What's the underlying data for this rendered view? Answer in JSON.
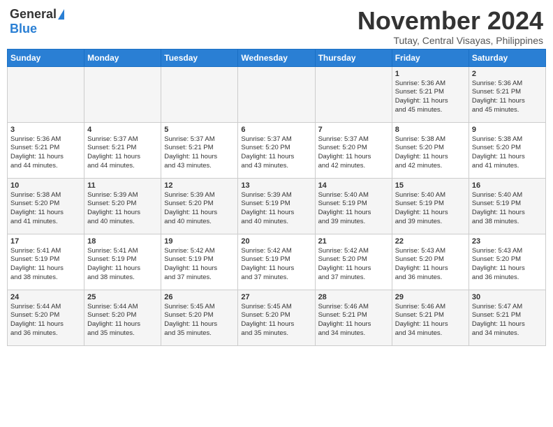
{
  "header": {
    "logo_general": "General",
    "logo_blue": "Blue",
    "month": "November 2024",
    "location": "Tutay, Central Visayas, Philippines"
  },
  "weekdays": [
    "Sunday",
    "Monday",
    "Tuesday",
    "Wednesday",
    "Thursday",
    "Friday",
    "Saturday"
  ],
  "weeks": [
    [
      {
        "day": "",
        "info": ""
      },
      {
        "day": "",
        "info": ""
      },
      {
        "day": "",
        "info": ""
      },
      {
        "day": "",
        "info": ""
      },
      {
        "day": "",
        "info": ""
      },
      {
        "day": "1",
        "info": "Sunrise: 5:36 AM\nSunset: 5:21 PM\nDaylight: 11 hours\nand 45 minutes."
      },
      {
        "day": "2",
        "info": "Sunrise: 5:36 AM\nSunset: 5:21 PM\nDaylight: 11 hours\nand 45 minutes."
      }
    ],
    [
      {
        "day": "3",
        "info": "Sunrise: 5:36 AM\nSunset: 5:21 PM\nDaylight: 11 hours\nand 44 minutes."
      },
      {
        "day": "4",
        "info": "Sunrise: 5:37 AM\nSunset: 5:21 PM\nDaylight: 11 hours\nand 44 minutes."
      },
      {
        "day": "5",
        "info": "Sunrise: 5:37 AM\nSunset: 5:21 PM\nDaylight: 11 hours\nand 43 minutes."
      },
      {
        "day": "6",
        "info": "Sunrise: 5:37 AM\nSunset: 5:20 PM\nDaylight: 11 hours\nand 43 minutes."
      },
      {
        "day": "7",
        "info": "Sunrise: 5:37 AM\nSunset: 5:20 PM\nDaylight: 11 hours\nand 42 minutes."
      },
      {
        "day": "8",
        "info": "Sunrise: 5:38 AM\nSunset: 5:20 PM\nDaylight: 11 hours\nand 42 minutes."
      },
      {
        "day": "9",
        "info": "Sunrise: 5:38 AM\nSunset: 5:20 PM\nDaylight: 11 hours\nand 41 minutes."
      }
    ],
    [
      {
        "day": "10",
        "info": "Sunrise: 5:38 AM\nSunset: 5:20 PM\nDaylight: 11 hours\nand 41 minutes."
      },
      {
        "day": "11",
        "info": "Sunrise: 5:39 AM\nSunset: 5:20 PM\nDaylight: 11 hours\nand 40 minutes."
      },
      {
        "day": "12",
        "info": "Sunrise: 5:39 AM\nSunset: 5:20 PM\nDaylight: 11 hours\nand 40 minutes."
      },
      {
        "day": "13",
        "info": "Sunrise: 5:39 AM\nSunset: 5:19 PM\nDaylight: 11 hours\nand 40 minutes."
      },
      {
        "day": "14",
        "info": "Sunrise: 5:40 AM\nSunset: 5:19 PM\nDaylight: 11 hours\nand 39 minutes."
      },
      {
        "day": "15",
        "info": "Sunrise: 5:40 AM\nSunset: 5:19 PM\nDaylight: 11 hours\nand 39 minutes."
      },
      {
        "day": "16",
        "info": "Sunrise: 5:40 AM\nSunset: 5:19 PM\nDaylight: 11 hours\nand 38 minutes."
      }
    ],
    [
      {
        "day": "17",
        "info": "Sunrise: 5:41 AM\nSunset: 5:19 PM\nDaylight: 11 hours\nand 38 minutes."
      },
      {
        "day": "18",
        "info": "Sunrise: 5:41 AM\nSunset: 5:19 PM\nDaylight: 11 hours\nand 38 minutes."
      },
      {
        "day": "19",
        "info": "Sunrise: 5:42 AM\nSunset: 5:19 PM\nDaylight: 11 hours\nand 37 minutes."
      },
      {
        "day": "20",
        "info": "Sunrise: 5:42 AM\nSunset: 5:19 PM\nDaylight: 11 hours\nand 37 minutes."
      },
      {
        "day": "21",
        "info": "Sunrise: 5:42 AM\nSunset: 5:20 PM\nDaylight: 11 hours\nand 37 minutes."
      },
      {
        "day": "22",
        "info": "Sunrise: 5:43 AM\nSunset: 5:20 PM\nDaylight: 11 hours\nand 36 minutes."
      },
      {
        "day": "23",
        "info": "Sunrise: 5:43 AM\nSunset: 5:20 PM\nDaylight: 11 hours\nand 36 minutes."
      }
    ],
    [
      {
        "day": "24",
        "info": "Sunrise: 5:44 AM\nSunset: 5:20 PM\nDaylight: 11 hours\nand 36 minutes."
      },
      {
        "day": "25",
        "info": "Sunrise: 5:44 AM\nSunset: 5:20 PM\nDaylight: 11 hours\nand 35 minutes."
      },
      {
        "day": "26",
        "info": "Sunrise: 5:45 AM\nSunset: 5:20 PM\nDaylight: 11 hours\nand 35 minutes."
      },
      {
        "day": "27",
        "info": "Sunrise: 5:45 AM\nSunset: 5:20 PM\nDaylight: 11 hours\nand 35 minutes."
      },
      {
        "day": "28",
        "info": "Sunrise: 5:46 AM\nSunset: 5:21 PM\nDaylight: 11 hours\nand 34 minutes."
      },
      {
        "day": "29",
        "info": "Sunrise: 5:46 AM\nSunset: 5:21 PM\nDaylight: 11 hours\nand 34 minutes."
      },
      {
        "day": "30",
        "info": "Sunrise: 5:47 AM\nSunset: 5:21 PM\nDaylight: 11 hours\nand 34 minutes."
      }
    ]
  ]
}
